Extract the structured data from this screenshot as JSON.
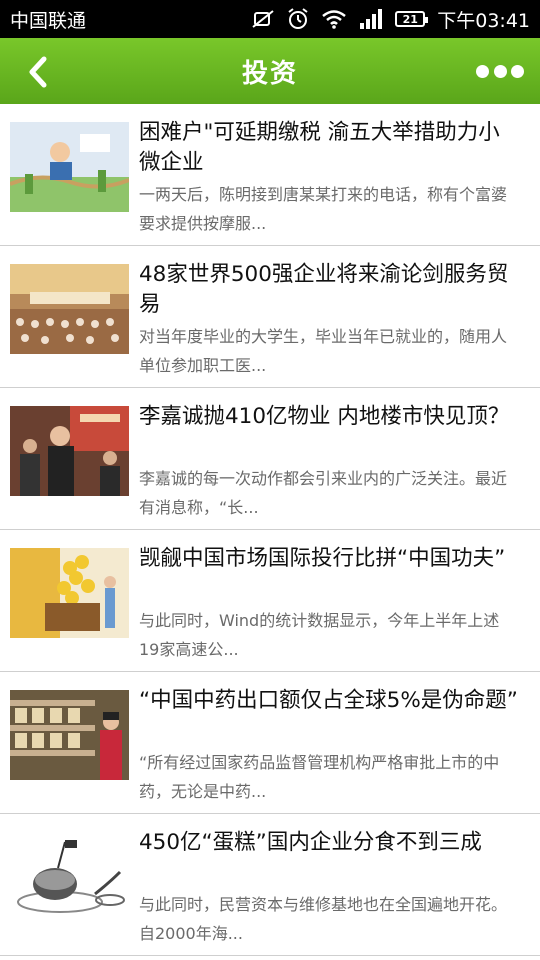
{
  "status_bar": {
    "carrier": "中国联通",
    "battery": "21",
    "time": "下午03:41"
  },
  "header": {
    "title": "投资"
  },
  "colors": {
    "header_green": "#6bb823",
    "status_bar": "#000000"
  },
  "articles": [
    {
      "title": "困难户\"可延期缴税 渝五大举措助力小微企业",
      "summary": "一两天后，陈明接到唐某某打来的电话，称有个富婆要求提供按摩服..."
    },
    {
      "title": "48家世界500强企业将来渝论剑服务贸易",
      "summary": "对当年度毕业的大学生，毕业当年已就业的，随用人单位参加职工医..."
    },
    {
      "title": "李嘉诚抛410亿物业 内地楼市快见顶？",
      "summary": "李嘉诚的每一次动作都会引来业内的广泛关注。最近有消息称，“长..."
    },
    {
      "title": "觊觎中国市场国际投行比拼“中国功夫”",
      "summary": "与此同时，Wind的统计数据显示，今年上半年上述19家高速公..."
    },
    {
      "title": "“中国中药出口额仅占全球5%是伪命题”",
      "summary": "“所有经过国家药品监督管理机构严格审批上市的中药，无论是中药..."
    },
    {
      "title": "450亿“蛋糕”国内企业分食不到三成",
      "summary": "与此同时，民营资本与维修基地也在全国遍地开花。自2000年海..."
    }
  ]
}
